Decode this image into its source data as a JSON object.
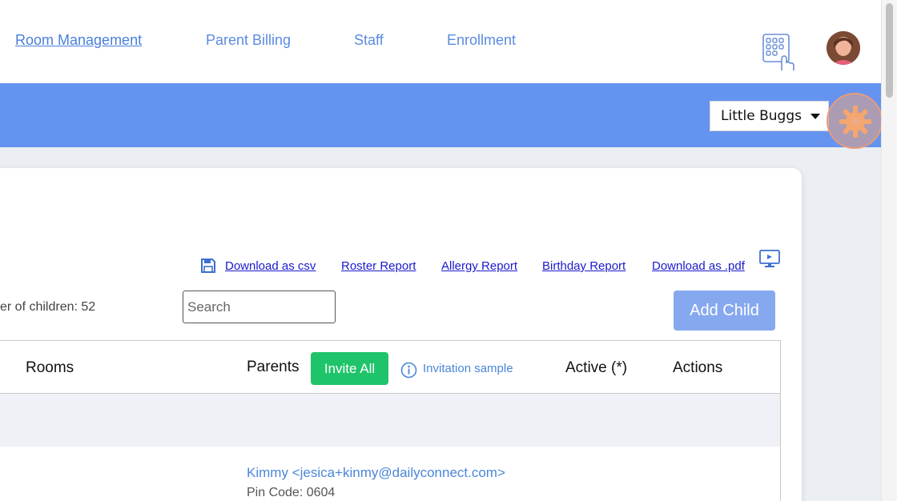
{
  "nav": {
    "items": [
      {
        "label": "Room Management",
        "active": true
      },
      {
        "label": "Parent Billing",
        "active": false
      },
      {
        "label": "Staff",
        "active": false
      },
      {
        "label": "Enrollment",
        "active": false
      }
    ],
    "kiosk_icon": "keypad-touch-icon",
    "avatar_icon": "user-avatar"
  },
  "toolbar": {
    "center_select_value": "Little Buggs",
    "settings_icon": "gear-icon"
  },
  "reports": {
    "download_csv": "Download as csv",
    "roster_report": "Roster Report",
    "allergy_report": "Allergy Report",
    "birthday_report": "Birthday Report",
    "download_pdf": "Download as .pdf",
    "save_icon": "floppy-disk-icon",
    "monitor_icon": "monitor-icon"
  },
  "filters": {
    "child_count_text": "er of children: 52",
    "search_placeholder": "Search",
    "add_child_label": "Add Child"
  },
  "table": {
    "headers": {
      "rooms": "Rooms",
      "parents": "Parents",
      "invite_all": "Invite All",
      "invitation_sample": "Invitation sample",
      "active": "Active (*)",
      "actions": "Actions"
    },
    "rows": [
      {
        "parent": "Kimmy <jesica+kinmy@dailyconnect.com>",
        "pin": "Pin Code: 0604"
      }
    ]
  },
  "colors": {
    "band": "#6594f0",
    "link": "#5b8be0",
    "invite_green": "#1fc46a",
    "add_child": "#86a8ef",
    "gear_highlight": "#e79c7c"
  }
}
